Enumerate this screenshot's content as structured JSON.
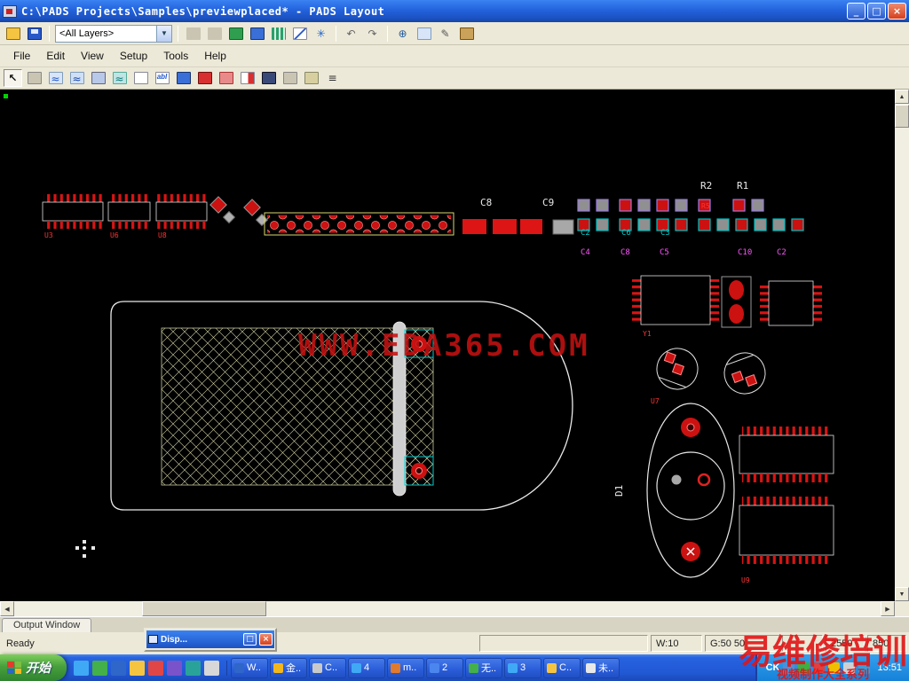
{
  "titlebar": {
    "title": "C:\\PADS Projects\\Samples\\previewplaced* - PADS Layout"
  },
  "menubar": {
    "items": [
      "File",
      "Edit",
      "View",
      "Setup",
      "Tools",
      "Help"
    ]
  },
  "toolbars": {
    "layer_selector": "<All Layers>",
    "abl_icon_text": "abl"
  },
  "glyphs": {
    "minimize": "_",
    "maximize": "□",
    "restore": "□",
    "close": "×",
    "dropdown": "▼",
    "undo": "↶",
    "redo": "↷",
    "select": "↖",
    "zoom": "⊕",
    "star": "✳",
    "pencil": "✎",
    "waves": "≈",
    "list": "≡",
    "up": "▲",
    "down": "▼",
    "left": "◀",
    "right": "▶"
  },
  "pcb": {
    "watermark": "WWW.EDA365.COM",
    "labels": {
      "c8": "C8",
      "c9": "C9",
      "r2": "R2",
      "r1": "R1",
      "r5": "R5",
      "d1": "D1",
      "u3": "U3",
      "u6": "U6",
      "u8": "U8",
      "y1": "Y1",
      "u7": "U7",
      "u9": "U9",
      "teal_row": [
        "C2",
        "C6",
        "C3"
      ],
      "magenta_row": [
        "C4",
        "C8",
        "C5",
        "C10",
        "C2"
      ]
    }
  },
  "output_window": {
    "tab": "Output Window"
  },
  "statusbar": {
    "ready": "Ready",
    "float_title": "Disp...",
    "fields": {
      "width": "W:10",
      "grid": "G:50 50",
      "x": "2550",
      "y": "850"
    }
  },
  "taskbar": {
    "start": "开始",
    "buttons": [
      "W..",
      "金..",
      "C..",
      "4",
      "m..",
      "2",
      "无..",
      "3",
      "C..",
      "未.."
    ],
    "tray": {
      "ime": "CK",
      "clock": "13:51"
    }
  },
  "overlay": {
    "line1": "易维修培训",
    "line2": "视频制作大全系列"
  }
}
